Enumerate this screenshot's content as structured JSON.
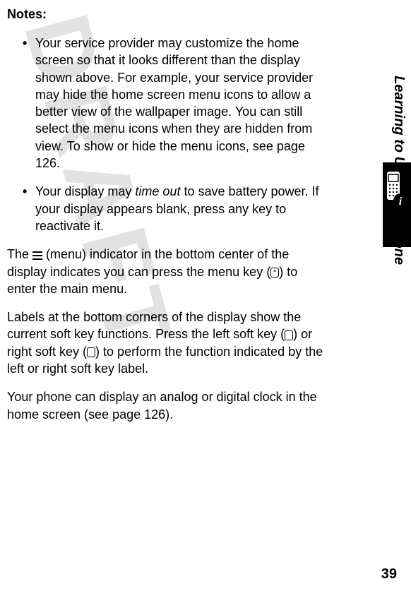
{
  "watermark": "DRAFT",
  "notes_heading": "Notes:",
  "bullet1": "Your service provider may customize the home screen so that it looks different than the display shown above. For example, your service provider may hide the home screen menu icons to allow a better view of the wallpaper image. You can still select the menu icons when they are hidden from view. To show or hide the menu icons, see page 126.",
  "bullet2_part1": "Your display may ",
  "bullet2_italic": "time out",
  "bullet2_part2": " to save battery power. If your display appears blank, press any key to reactivate it.",
  "para1_part1": "The ",
  "para1_part2": " (menu) indicator in the bottom center of the display indicates you can press the menu key (",
  "para1_part3": ") to enter the main menu.",
  "para2_part1": "Labels at the bottom corners of the display show the current soft key functions. Press the left soft key (",
  "para2_part2": ") or right soft key (",
  "para2_part3": ") to perform the function indicated by the left or right soft key label.",
  "para3": "Your phone can display an analog or digital clock in the home screen (see page 126).",
  "side_label": "Learning to Use Your Phone",
  "page_number": "39"
}
